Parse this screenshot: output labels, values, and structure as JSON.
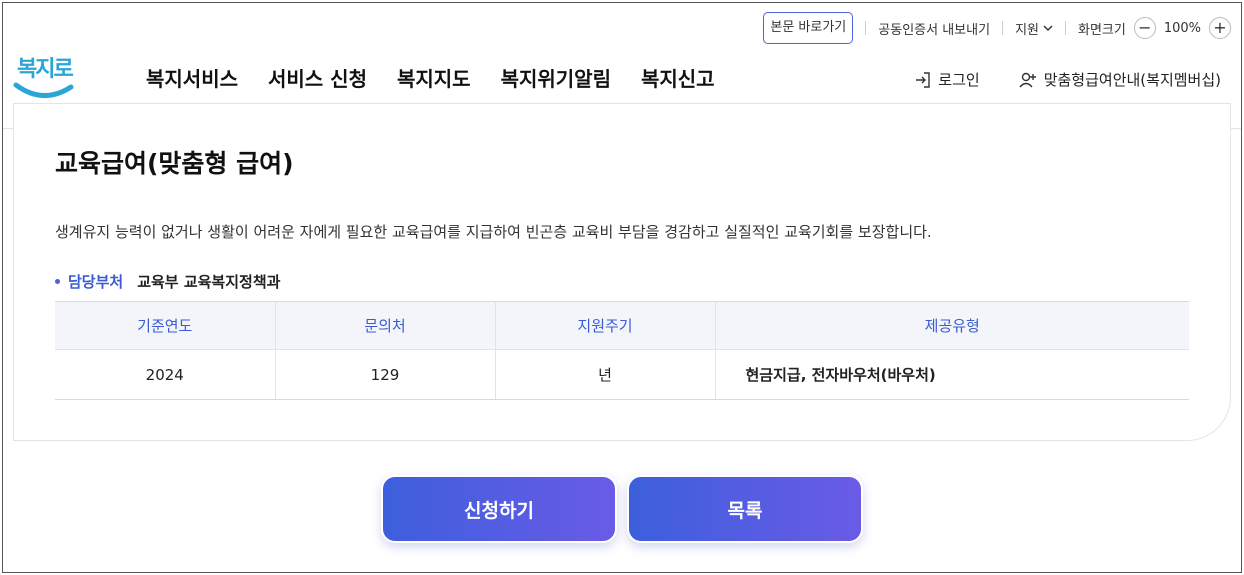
{
  "utility": {
    "skip_link": "본문 바로가기",
    "cert_export": "공동인증서 내보내기",
    "support": "지원",
    "screen_size": "화면크기",
    "zoom_minus": "−",
    "zoom_value": "100%",
    "zoom_plus": "+"
  },
  "logo": {
    "text": "복지로"
  },
  "nav": [
    "복지서비스",
    "서비스 신청",
    "복지지도",
    "복지위기알림",
    "복지신고"
  ],
  "member": {
    "login": "로그인",
    "membership": "맞춤형급여안내(복지멤버십)"
  },
  "content": {
    "title": "교육급여(맞춤형 급여)",
    "description": "생계유지 능력이 없거나 생활이 어려운 자에게 필요한 교육급여를 지급하여 빈곤층 교육비 부담을 경감하고 실질적인 교육기회를 보장합니다.",
    "dept_label": "담당부처",
    "dept_value": "교육부 교육복지정책과",
    "table": {
      "headers": [
        "기준연도",
        "문의처",
        "지원주기",
        "제공유형"
      ],
      "row": [
        "2024",
        "129",
        "년",
        "현금지급, 전자바우처(바우처)"
      ]
    }
  },
  "buttons": {
    "apply": "신청하기",
    "list": "목록"
  },
  "colors": {
    "accent": "#3b5bd6",
    "button_start": "#3d5fdc",
    "button_end": "#6a5be6",
    "logo": "#2aa6d6"
  }
}
